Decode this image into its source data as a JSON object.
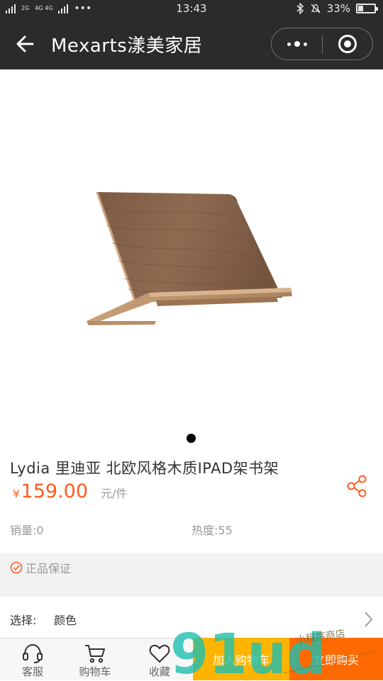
{
  "status_bar": {
    "carrier_left": "2G",
    "network": "4G 4G",
    "more": "•••",
    "time": "13:43",
    "battery": "33%",
    "battery_level": 0.33
  },
  "nav": {
    "title": "Mexarts漾美家居"
  },
  "carousel": {
    "total": 1,
    "active": 1
  },
  "product": {
    "title": "Lydia 里迪亚 北欧风格木质IPAD架书架",
    "currency": "¥",
    "price": "159.00",
    "unit": "元/件",
    "sales": "销量:0",
    "heat": "热度:55",
    "guarantee": "正品保证"
  },
  "options": {
    "label": "选择:",
    "value": "颜色"
  },
  "bottom_bar": {
    "service": "客服",
    "cart": "购物车",
    "favorite": "收藏",
    "add_to_cart": "加入购物车",
    "buy_now": "立即购买"
  },
  "watermark": {
    "logo": "91ud",
    "tagline": "小程序商店"
  },
  "colors": {
    "accent": "#ff5a1f",
    "add_cart_bg": "#ffb400",
    "buy_now_bg": "#ff6a00",
    "nav_bg": "#2b2b2b"
  },
  "icons": [
    "signal-icon",
    "bluetooth-icon",
    "mute-icon",
    "battery-icon",
    "back-arrow-icon",
    "more-icon",
    "close-mini-program-icon",
    "share-icon",
    "check-circle-icon",
    "chevron-right-icon",
    "headset-icon",
    "cart-icon",
    "heart-icon"
  ]
}
